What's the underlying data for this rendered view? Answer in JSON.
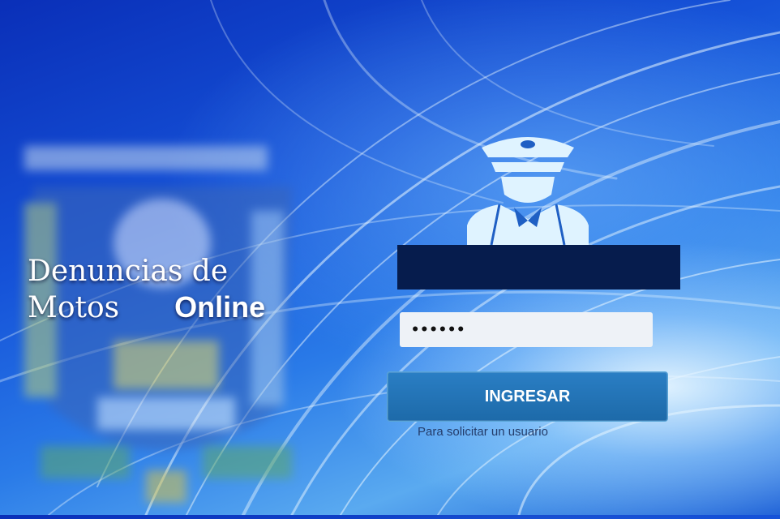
{
  "branding": {
    "title_line1": "Denuncias de",
    "title_line2": "Motos",
    "title_online": "Online"
  },
  "login": {
    "username_field": "",
    "password_masked": "••••••",
    "submit_label": "INGRESAR",
    "request_user_text": "Para solicitar un usuario"
  },
  "icons": {
    "officer": "police-officer-icon",
    "emblem": "blurred-shield-emblem"
  },
  "colors": {
    "background_primary": "#1552d8",
    "redaction_bar": "#061c4d",
    "button": "#1d6aa9",
    "button_text": "#ffffff"
  }
}
